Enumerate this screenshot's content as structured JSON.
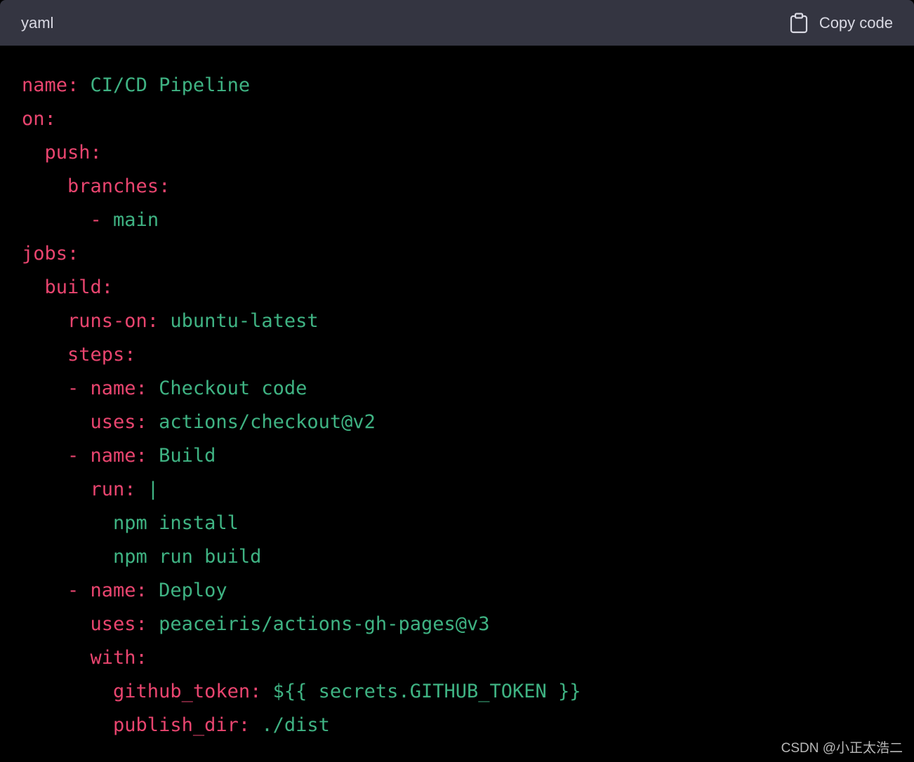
{
  "header": {
    "language": "yaml",
    "copy_label": "Copy code",
    "copy_icon": "clipboard-icon"
  },
  "colors": {
    "header_bg": "#343541",
    "code_bg": "#000000",
    "key": "#e9456f",
    "value": "#3fb383"
  },
  "code_lines": [
    [
      {
        "t": "name: ",
        "c": "key"
      },
      {
        "t": "CI/CD Pipeline",
        "c": "val"
      }
    ],
    [
      {
        "t": "on:",
        "c": "key"
      }
    ],
    [
      {
        "t": "  push:",
        "c": "key"
      }
    ],
    [
      {
        "t": "    branches:",
        "c": "key"
      }
    ],
    [
      {
        "t": "      - ",
        "c": "key"
      },
      {
        "t": "main",
        "c": "val"
      }
    ],
    [
      {
        "t": "jobs:",
        "c": "key"
      }
    ],
    [
      {
        "t": "  build:",
        "c": "key"
      }
    ],
    [
      {
        "t": "    runs-on: ",
        "c": "key"
      },
      {
        "t": "ubuntu-latest",
        "c": "val"
      }
    ],
    [
      {
        "t": "    steps:",
        "c": "key"
      }
    ],
    [
      {
        "t": "    - name: ",
        "c": "key"
      },
      {
        "t": "Checkout code",
        "c": "val"
      }
    ],
    [
      {
        "t": "      uses: ",
        "c": "key"
      },
      {
        "t": "actions/checkout@v2",
        "c": "val"
      }
    ],
    [
      {
        "t": "    - name: ",
        "c": "key"
      },
      {
        "t": "Build",
        "c": "val"
      }
    ],
    [
      {
        "t": "      run: ",
        "c": "key"
      },
      {
        "t": "|",
        "c": "val"
      }
    ],
    [
      {
        "t": "        npm install",
        "c": "val"
      }
    ],
    [
      {
        "t": "        npm run build",
        "c": "val"
      }
    ],
    [
      {
        "t": "    - name: ",
        "c": "key"
      },
      {
        "t": "Deploy",
        "c": "val"
      }
    ],
    [
      {
        "t": "      uses: ",
        "c": "key"
      },
      {
        "t": "peaceiris/actions-gh-pages@v3",
        "c": "val"
      }
    ],
    [
      {
        "t": "      with:",
        "c": "key"
      }
    ],
    [
      {
        "t": "        github_token: ",
        "c": "key"
      },
      {
        "t": "${{ secrets.GITHUB_TOKEN }}",
        "c": "val"
      }
    ],
    [
      {
        "t": "        publish_dir: ",
        "c": "key"
      },
      {
        "t": "./dist",
        "c": "val"
      }
    ]
  ],
  "watermark": "CSDN @小正太浩二"
}
